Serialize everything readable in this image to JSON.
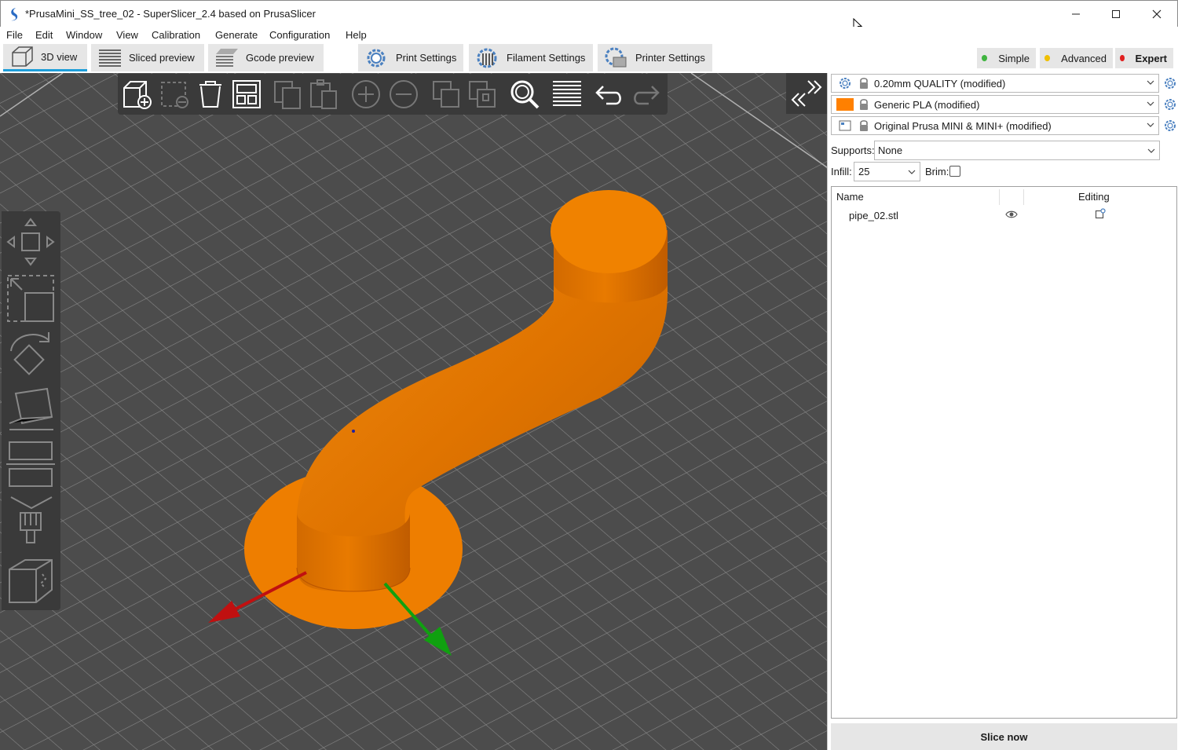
{
  "window": {
    "title": "*PrusaMini_SS_tree_02 - SuperSlicer_2.4  based on PrusaSlicer",
    "minimize_icon": "minimize-icon",
    "maximize_icon": "maximize-icon",
    "close_icon": "close-icon"
  },
  "menu": [
    "File",
    "Edit",
    "Window",
    "View",
    "Calibration",
    "Generate",
    "Configuration",
    "Help"
  ],
  "tabs": [
    {
      "label": "3D view",
      "icon": "cube-icon",
      "active": true
    },
    {
      "label": "Sliced preview",
      "icon": "layers-icon",
      "active": false
    },
    {
      "label": "Gcode preview",
      "icon": "gcode-icon",
      "active": false
    },
    {
      "label": "Print Settings",
      "icon": "gear-icon",
      "active": false
    },
    {
      "label": "Filament Settings",
      "icon": "spool-icon",
      "active": false
    },
    {
      "label": "Printer Settings",
      "icon": "printer-gear-icon",
      "active": false
    }
  ],
  "modes": [
    {
      "label": "Simple",
      "color": "#3fb43f"
    },
    {
      "label": "Advanced",
      "color": "#f0c000"
    },
    {
      "label": "Expert",
      "color": "#e02020",
      "active": true
    }
  ],
  "top_toolbar": [
    "add-object-icon",
    "delete-icon",
    "delete-all-icon",
    "arrange-icon",
    "copy-icon",
    "paste-icon",
    "add-instance-icon",
    "remove-instance-icon",
    "split-objects-icon",
    "split-parts-icon",
    "search-icon",
    "layers-editing-icon",
    "undo-icon",
    "redo-icon"
  ],
  "left_toolbar": [
    "move-icon",
    "scale-icon",
    "rotate-icon",
    "place-on-face-icon",
    "cut-icon",
    "paint-supports-icon",
    "seam-icon"
  ],
  "presets": {
    "print": "0.20mm QUALITY (modified)",
    "filament": "Generic PLA (modified)",
    "filament_color": "#ff8000",
    "printer": "Original Prusa MINI & MINI+ (modified)"
  },
  "supports": {
    "label": "Supports:",
    "value": "None"
  },
  "infill": {
    "label": "Infill:",
    "value": "25"
  },
  "brim": {
    "label": "Brim:",
    "checked": false
  },
  "object_list": {
    "columns": [
      "Name",
      "Editing"
    ],
    "rows": [
      {
        "name": "pipe_02.stl"
      }
    ]
  },
  "slice_button": "Slice now",
  "colors": {
    "model": "#e87700",
    "bed": "#4c4c4c",
    "accent": "#1e9ed9"
  }
}
